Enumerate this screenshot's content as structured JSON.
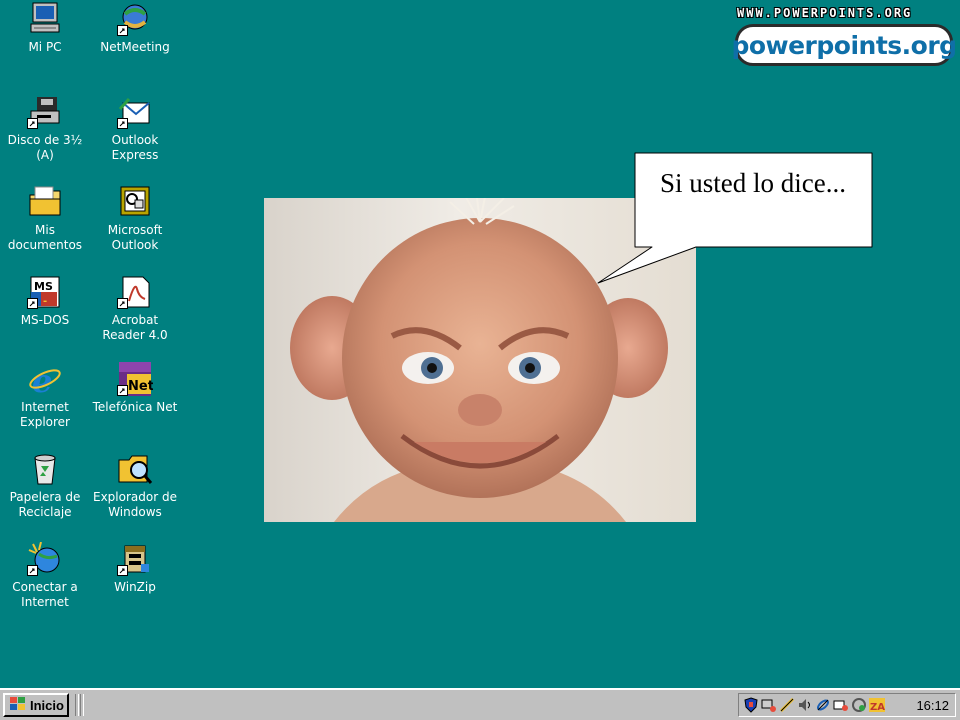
{
  "desktop": {
    "icons": [
      {
        "label": "Mi PC",
        "icon": "my-computer-icon"
      },
      {
        "label": "NetMeeting",
        "icon": "netmeeting-icon"
      },
      {
        "label": "Disco de 3½ (A)",
        "icon": "floppy-drive-icon"
      },
      {
        "label": "Outlook Express",
        "icon": "outlook-express-icon"
      },
      {
        "label": "Mis documentos",
        "icon": "folder-icon"
      },
      {
        "label": "Microsoft Outlook",
        "icon": "microsoft-outlook-icon"
      },
      {
        "label": "MS-DOS",
        "icon": "ms-dos-icon"
      },
      {
        "label": "Acrobat Reader 4.0",
        "icon": "acrobat-reader-icon"
      },
      {
        "label": "Internet Explorer",
        "icon": "internet-explorer-icon"
      },
      {
        "label": "Telefónica Net",
        "icon": "telefonica-net-icon"
      },
      {
        "label": "Papelera de Reciclaje",
        "icon": "recycle-bin-icon"
      },
      {
        "label": "Explorador de Windows",
        "icon": "windows-explorer-icon"
      },
      {
        "label": "Conectar a Internet",
        "icon": "connect-internet-icon"
      },
      {
        "label": "WinZip",
        "icon": "winzip-icon"
      }
    ]
  },
  "brand": {
    "url": "WWW.POWERPOINTS.ORG",
    "logo": "powerpoints.org"
  },
  "bubble": {
    "text": "Si usted lo dice..."
  },
  "taskbar": {
    "start_label": "Inicio",
    "clock": "16:12",
    "tray_icons": [
      "antivirus-shield-icon",
      "network-icon",
      "connection-icon",
      "volume-icon",
      "link-icon",
      "mail-icon",
      "security-icon",
      "zonealarm-icon"
    ]
  },
  "colors": {
    "desktop": "#008080",
    "taskbar": "#c0c0c0"
  }
}
